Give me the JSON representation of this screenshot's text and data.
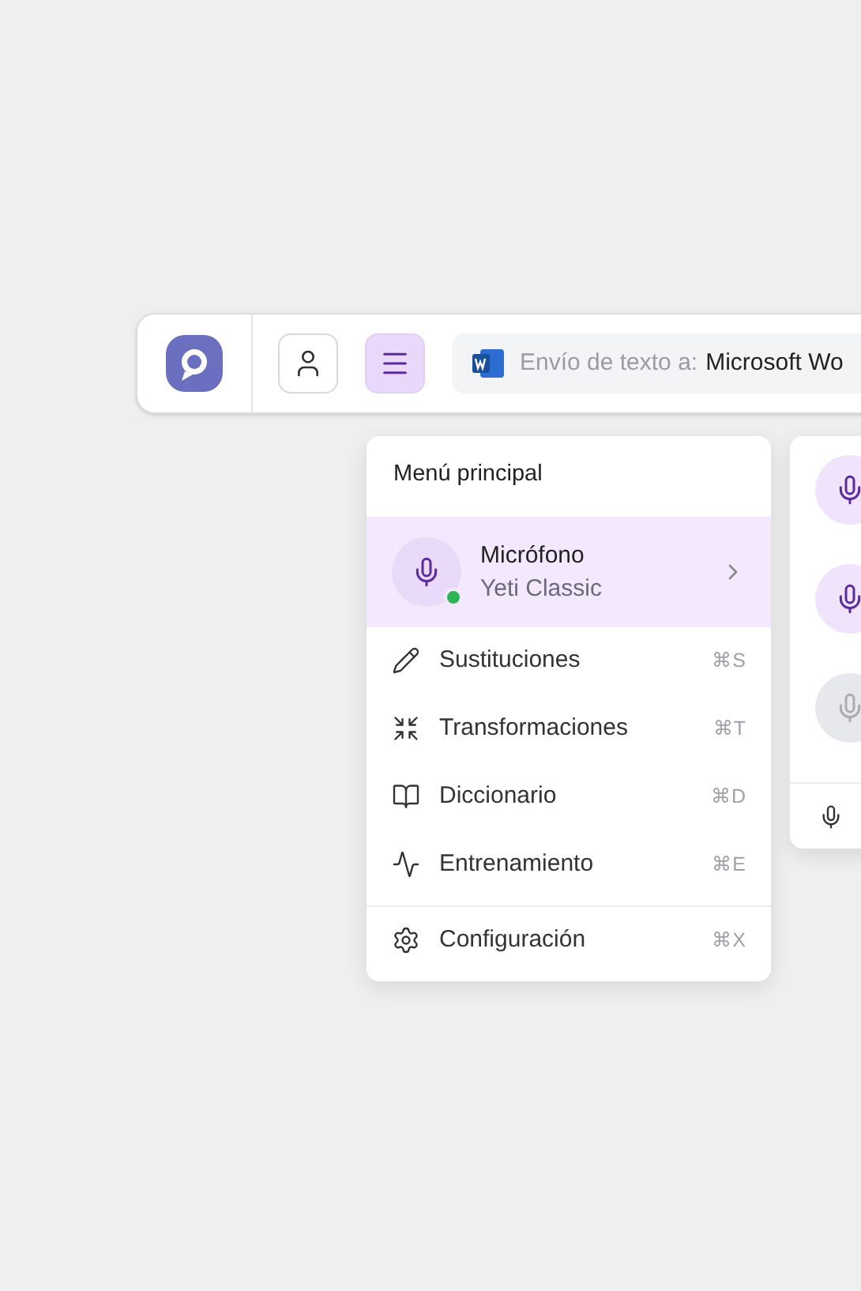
{
  "toolbar": {
    "menu_open": true,
    "send_target": {
      "label": "Envío de texto a:",
      "app": "Microsoft Wo"
    }
  },
  "menu": {
    "title": "Menú principal",
    "microphone": {
      "label": "Micrófono",
      "device": "Yeti Classic",
      "connected": true,
      "selected": true
    },
    "items": [
      {
        "kind": "pencil",
        "label": "Sustituciones",
        "shortcut": "⌘S",
        "selected": false
      },
      {
        "kind": "compress",
        "label": "Transformaciones",
        "shortcut": "⌘T",
        "selected": false
      },
      {
        "kind": "book",
        "label": "Diccionario",
        "shortcut": "⌘D",
        "selected": false
      },
      {
        "kind": "activity",
        "label": "Entrenamiento",
        "shortcut": "⌘E",
        "selected": false
      },
      {
        "kind": "gear",
        "label": "Configuración",
        "shortcut": "⌘X",
        "selected": false
      }
    ]
  },
  "submenu": {
    "devices": [
      {
        "disabled": false
      },
      {
        "disabled": false
      },
      {
        "disabled": true
      }
    ]
  }
}
